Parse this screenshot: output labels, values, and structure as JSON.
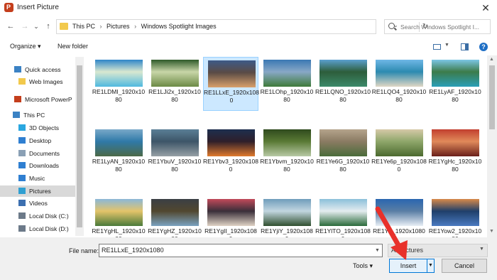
{
  "window": {
    "title": "Insert Picture",
    "app_icon_letter": "P",
    "close_glyph": "✕"
  },
  "nav": {
    "back_glyph": "←",
    "forward_glyph": "→",
    "dropdown_glyph": "⌄",
    "up_glyph": "↑",
    "breadcrumbs": [
      "This PC",
      "Pictures",
      "Windows Spotlight Images"
    ],
    "sep": "›",
    "refresh_glyph": "↻",
    "search_placeholder": "Search Windows Spotlight I..."
  },
  "toolbar": {
    "organize_label": "Organize ▾",
    "new_folder_label": "New folder",
    "help": "?"
  },
  "sidebar": {
    "items": [
      {
        "label": "Quick access",
        "icon": "star-icon",
        "color": "#3b82c4"
      },
      {
        "label": "Web Images",
        "icon": "folder-icon",
        "color": "#f2c94c"
      },
      {
        "label": "Microsoft PowerP",
        "icon": "powerpoint-icon",
        "color": "#c43e1c"
      },
      {
        "label": "This PC",
        "icon": "computer-icon",
        "color": "#3b82c4"
      },
      {
        "label": "3D Objects",
        "icon": "cube-icon",
        "color": "#2aa7e0"
      },
      {
        "label": "Desktop",
        "icon": "desktop-icon",
        "color": "#2f7fd1"
      },
      {
        "label": "Documents",
        "icon": "document-icon",
        "color": "#8aa0b5"
      },
      {
        "label": "Downloads",
        "icon": "download-icon",
        "color": "#2f7fd1"
      },
      {
        "label": "Music",
        "icon": "music-icon",
        "color": "#2f7fd1"
      },
      {
        "label": "Pictures",
        "icon": "pictures-icon",
        "color": "#2f9fd1"
      },
      {
        "label": "Videos",
        "icon": "video-icon",
        "color": "#3c6fb0"
      },
      {
        "label": "Local Disk (C:)",
        "icon": "disk-icon",
        "color": "#6c7a89"
      },
      {
        "label": "Local Disk (D:)",
        "icon": "disk-icon",
        "color": "#6c7a89"
      }
    ]
  },
  "files": [
    {
      "name": "RE1LDMI_1920x1080",
      "colors": [
        "#2f86c8",
        "#4fb9df",
        "#d9e8d0"
      ]
    },
    {
      "name": "RE1LJi2x_1920x1080",
      "colors": [
        "#2e5a2a",
        "#6c8a45",
        "#c8d6a8"
      ]
    },
    {
      "name": "RE1LLxE_1920x1080",
      "colors": [
        "#3d5a88",
        "#d8a06b",
        "#5a4b45"
      ]
    },
    {
      "name": "RE1LOhp_1920x1080",
      "colors": [
        "#3a78b3",
        "#3f7b3a",
        "#88a8c6"
      ]
    },
    {
      "name": "RE1LQNO_1920x1080",
      "colors": [
        "#5aa0cf",
        "#3c8a6a",
        "#2d5d3b"
      ]
    },
    {
      "name": "RE1LQO4_1920x1080",
      "colors": [
        "#6fb7e6",
        "#e0d7c4",
        "#2c8ab0"
      ]
    },
    {
      "name": "RE1LyAF_1920x1080",
      "colors": [
        "#7cc6e5",
        "#2a9fb7",
        "#3c7b4a"
      ]
    },
    {
      "name": "RE1LyAN_1920x1080",
      "colors": [
        "#7aa9c9",
        "#4c6a48",
        "#2f79a8"
      ]
    },
    {
      "name": "RE1YbuV_1920x1080",
      "colors": [
        "#5a7f96",
        "#96a0a5",
        "#3d5568"
      ]
    },
    {
      "name": "RE1Ybv3_1920x1080",
      "colors": [
        "#1d2f4f",
        "#e07a2d",
        "#2f1f2a"
      ]
    },
    {
      "name": "RE1Ybvm_1920x1080",
      "colors": [
        "#2f4a1d",
        "#b7c9a5",
        "#5a7a35"
      ]
    },
    {
      "name": "RE1Ye6G_1920x1080",
      "colors": [
        "#b5a48c",
        "#4a6c3a",
        "#8a7b63"
      ]
    },
    {
      "name": "RE1Ye6p_1920x1080",
      "colors": [
        "#d6c9a8",
        "#4c6a2f",
        "#8ea66a"
      ]
    },
    {
      "name": "RE1YgHc_1920x1080",
      "colors": [
        "#c23e2e",
        "#6a1f1a",
        "#e08a5a"
      ]
    },
    {
      "name": "RE1YgHL_1920x1080",
      "colors": [
        "#8bb8d8",
        "#4a7a3a",
        "#e3c46a"
      ]
    },
    {
      "name": "RE1YgHZ_1920x1080",
      "colors": [
        "#3a3f45",
        "#7aa2c0",
        "#51472f"
      ]
    },
    {
      "name": "RE1YgII_1920x1080",
      "colors": [
        "#c24a5a",
        "#e0d3c5",
        "#3a2f3a"
      ]
    },
    {
      "name": "RE1YjiY_1920x1080",
      "colors": [
        "#6f9dbb",
        "#2f4f2f",
        "#c2d6e0"
      ]
    },
    {
      "name": "RE1YlTO_1920x1080",
      "colors": [
        "#8bc0da",
        "#2a6a3a",
        "#e4ecef"
      ]
    },
    {
      "name": "RE1Yn_1920x1080",
      "colors": [
        "#2a66b0",
        "#e8eef5",
        "#5a7ea5"
      ]
    },
    {
      "name": "RE1Yow2_1920x1080",
      "colors": [
        "#d88a4a",
        "#4a7ac0",
        "#1f3f6a"
      ]
    }
  ],
  "selected_index": 2,
  "bottom": {
    "filename_label": "File name:",
    "filename_value": "RE1LLxE_1920x1080",
    "filter_value": "All Pictures",
    "tools_label": "Tools ▾",
    "insert_label": "Insert",
    "cancel_label": "Cancel"
  },
  "accent": {
    "arrow_color": "#e8302a",
    "selection_bg": "#cce8ff"
  }
}
